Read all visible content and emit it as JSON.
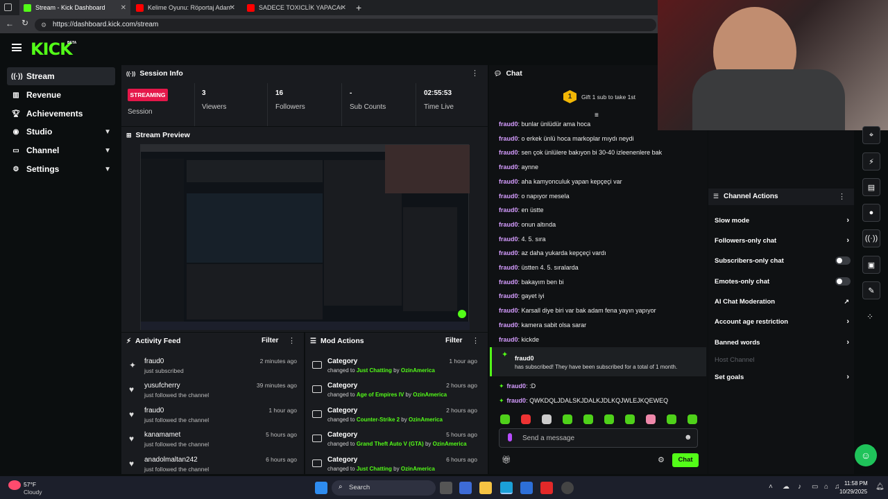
{
  "browser": {
    "tabs": [
      {
        "title": "Stream - Kick Dashboard",
        "active": true,
        "favicon_color": "#53fc18"
      },
      {
        "title": "Kelime Oyunu: Röportaj Adam Ke",
        "active": false,
        "favicon_color": "#ff0000"
      },
      {
        "title": "SADECE TOXICLİK YAPACAĞIM! | ",
        "active": false,
        "favicon_color": "#ff0000"
      }
    ],
    "url": "https://dashboard.kick.com/stream"
  },
  "header": {
    "logo": "KICK",
    "badge": "BETA"
  },
  "sidebar": {
    "items": [
      {
        "label": "Stream",
        "icon": "broadcast-icon",
        "active": true
      },
      {
        "label": "Revenue",
        "icon": "chart-icon"
      },
      {
        "label": "Achievements",
        "icon": "trophy-icon"
      },
      {
        "label": "Studio",
        "icon": "studio-icon",
        "expandable": true
      },
      {
        "label": "Channel",
        "icon": "channel-icon",
        "expandable": true
      },
      {
        "label": "Settings",
        "icon": "gear-icon",
        "expandable": true
      }
    ]
  },
  "session": {
    "title": "Session Info",
    "status": "STREAMING",
    "status_sub": "Session",
    "stats": [
      {
        "value": "3",
        "label": "Viewers"
      },
      {
        "value": "16",
        "label": "Followers"
      },
      {
        "value": "-",
        "label": "Sub Counts"
      },
      {
        "value": "02:55:53",
        "label": "Time Live"
      }
    ]
  },
  "preview": {
    "title": "Stream Preview"
  },
  "activity": {
    "title": "Activity Feed",
    "filter": "Filter",
    "items": [
      {
        "name": "fraud0",
        "desc": "just subscribed",
        "time": "2 minutes ago",
        "icon": "star-icon"
      },
      {
        "name": "yusufcherry",
        "desc": "just followed the channel",
        "time": "39 minutes ago",
        "icon": "heart-icon"
      },
      {
        "name": "fraud0",
        "desc": "just followed the channel",
        "time": "1 hour ago",
        "icon": "heart-icon"
      },
      {
        "name": "kanamamet",
        "desc": "just followed the channel",
        "time": "5 hours ago",
        "icon": "heart-icon"
      },
      {
        "name": "anadolmaltan242",
        "desc": "just followed the channel",
        "time": "6 hours ago",
        "icon": "heart-icon"
      }
    ]
  },
  "mod": {
    "title": "Mod Actions",
    "filter": "Filter",
    "changed": "changed to",
    "by": "by",
    "items": [
      {
        "name": "Category",
        "game": "Just Chatting",
        "user": "OzinAmerica",
        "time": "1 hour ago"
      },
      {
        "name": "Category",
        "game": "Age of Empires IV",
        "user": "OzinAmerica",
        "time": "2 hours ago"
      },
      {
        "name": "Category",
        "game": "Counter-Strike 2",
        "user": "OzinAmerica",
        "time": "2 hours ago"
      },
      {
        "name": "Category",
        "game": "Grand Theft Auto V (GTA)",
        "user": "OzinAmerica",
        "time": "5 hours ago"
      },
      {
        "name": "Category",
        "game": "Just Chatting",
        "user": "OzinAmerica",
        "time": "6 hours ago"
      }
    ]
  },
  "chat": {
    "title": "Chat",
    "gift_badge": "1",
    "gift_text": "Gift 1 sub to take 1st",
    "messages": [
      {
        "user": "fraud0",
        "text": "bunlar ünlüdür ama hoca"
      },
      {
        "user": "fraud0",
        "text": "o erkek ünlü hoca markoplar mıydı neydi"
      },
      {
        "user": "fraud0",
        "text": "sen çok ünlülere bakıyon bi 30-40 izleenenlere bak"
      },
      {
        "user": "fraud0",
        "text": "aynne"
      },
      {
        "user": "fraud0",
        "text": "aha kamyonculuk yapan kepçeçi var"
      },
      {
        "user": "fraud0",
        "text": "o napıyor mesela"
      },
      {
        "user": "fraud0",
        "text": "en üstte"
      },
      {
        "user": "fraud0",
        "text": "onun altında"
      },
      {
        "user": "fraud0",
        "text": "4. 5. sıra"
      },
      {
        "user": "fraud0",
        "text": "az daha yukarda kepçeçi vardı"
      },
      {
        "user": "fraud0",
        "text": "üstten 4. 5. sıralarda"
      },
      {
        "user": "fraud0",
        "text": "bakayım ben bi"
      },
      {
        "user": "fraud0",
        "text": "gayet iyi"
      },
      {
        "user": "fraud0",
        "text": "Karsall diye biri var bak adam fena yayın yapıyor"
      },
      {
        "user": "fraud0",
        "text": "kamera sabit olsa sarar"
      },
      {
        "user": "fraud0",
        "text": "kickde"
      }
    ],
    "sub_event": {
      "user": "fraud0",
      "text": "has subscribed! They have been subscribed for a total of 1 month."
    },
    "after": [
      {
        "user": "fraud0",
        "text": ":D"
      },
      {
        "user": "fraud0",
        "text": "QWKDQLJDALSKJDALKJDLKQJWLEJKQEWEQ"
      }
    ],
    "input_placeholder": "Send a message",
    "send_label": "Chat"
  },
  "channel_actions": {
    "title": "Channel Actions",
    "items": [
      {
        "label": "Slow mode",
        "type": "arrow"
      },
      {
        "label": "Followers-only chat",
        "type": "arrow"
      },
      {
        "label": "Subscribers-only chat",
        "type": "toggle"
      },
      {
        "label": "Emotes-only chat",
        "type": "toggle"
      },
      {
        "label": "AI Chat Moderation",
        "type": "external"
      },
      {
        "label": "Account age restriction",
        "type": "arrow"
      },
      {
        "label": "Banned words",
        "type": "arrow"
      },
      {
        "label": "Host Channel",
        "type": "disabled"
      },
      {
        "label": "Set goals",
        "type": "arrow"
      }
    ]
  },
  "taskbar": {
    "weather_temp": "57°F",
    "weather_desc": "Cloudy",
    "search": "Search",
    "time": "11:58 PM",
    "date": "10/29/2025"
  },
  "colors": {
    "accent": "#53fc18",
    "streaming": "#e5174a",
    "chat_user": "#d59cff"
  }
}
